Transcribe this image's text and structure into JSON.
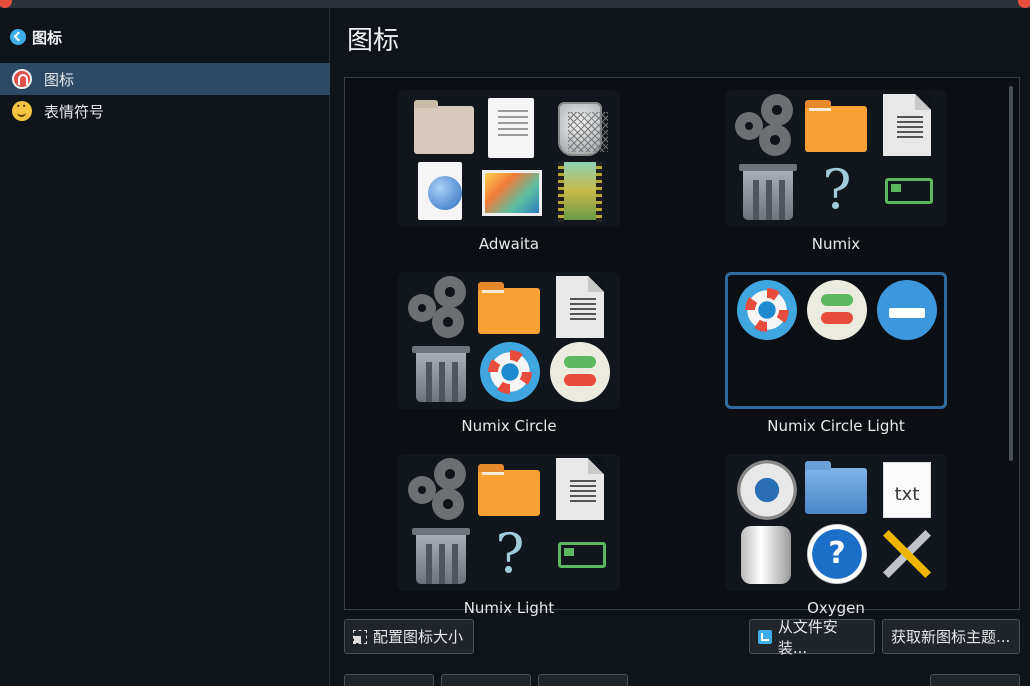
{
  "sidebar": {
    "back_label": "图标",
    "items": [
      {
        "label": "图标",
        "icon": "icons-category-icon",
        "active": true
      },
      {
        "label": "表情符号",
        "icon": "emoji-icon",
        "active": false
      }
    ]
  },
  "main": {
    "title": "图标",
    "themes": [
      {
        "name": "Adwaita"
      },
      {
        "name": "Numix"
      },
      {
        "name": "Numix Circle"
      },
      {
        "name": "Numix Circle Light",
        "selected": true
      },
      {
        "name": "Numix Light"
      },
      {
        "name": "Oxygen"
      }
    ],
    "txt_label": "txt",
    "question_glyph": "?"
  },
  "buttons": {
    "configure_size": "配置图标大小",
    "install_from_file": "从文件安装...",
    "get_new_themes": "获取新图标主题..."
  },
  "colors": {
    "accent": "#3daee9",
    "selection": "#2c4a66",
    "selected_border": "#2e6da4"
  }
}
